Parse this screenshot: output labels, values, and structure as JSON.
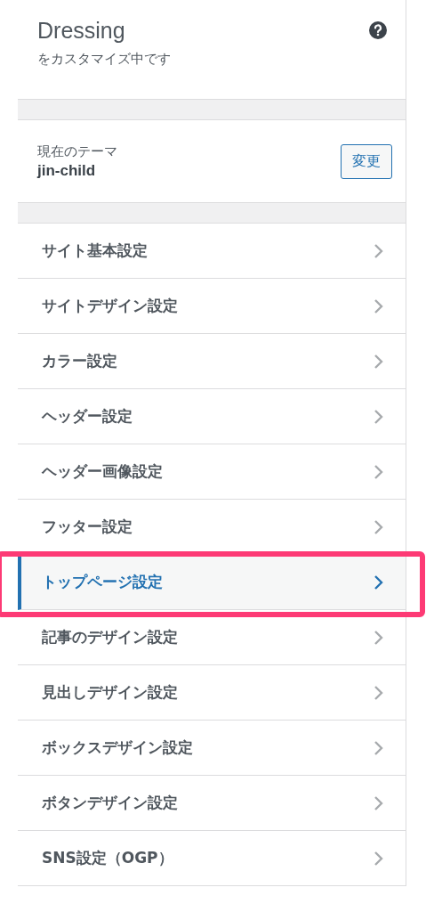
{
  "header": {
    "title": "Dressing",
    "subtitle": "をカスタマイズ中です"
  },
  "theme": {
    "label": "現在のテーマ",
    "name": "jin-child",
    "button": "変更"
  },
  "sections": [
    {
      "label": "サイト基本設定",
      "selected": false,
      "annotated": false
    },
    {
      "label": "サイトデザイン設定",
      "selected": false,
      "annotated": false
    },
    {
      "label": "カラー設定",
      "selected": false,
      "annotated": false
    },
    {
      "label": "ヘッダー設定",
      "selected": false,
      "annotated": false
    },
    {
      "label": "ヘッダー画像設定",
      "selected": false,
      "annotated": false
    },
    {
      "label": "フッター設定",
      "selected": false,
      "annotated": false
    },
    {
      "label": "トップページ設定",
      "selected": true,
      "annotated": true
    },
    {
      "label": "記事のデザイン設定",
      "selected": false,
      "annotated": false
    },
    {
      "label": "見出しデザイン設定",
      "selected": false,
      "annotated": false
    },
    {
      "label": "ボックスデザイン設定",
      "selected": false,
      "annotated": false
    },
    {
      "label": "ボタンデザイン設定",
      "selected": false,
      "annotated": false
    },
    {
      "label": "SNS設定（OGP）",
      "selected": false,
      "annotated": false
    }
  ]
}
